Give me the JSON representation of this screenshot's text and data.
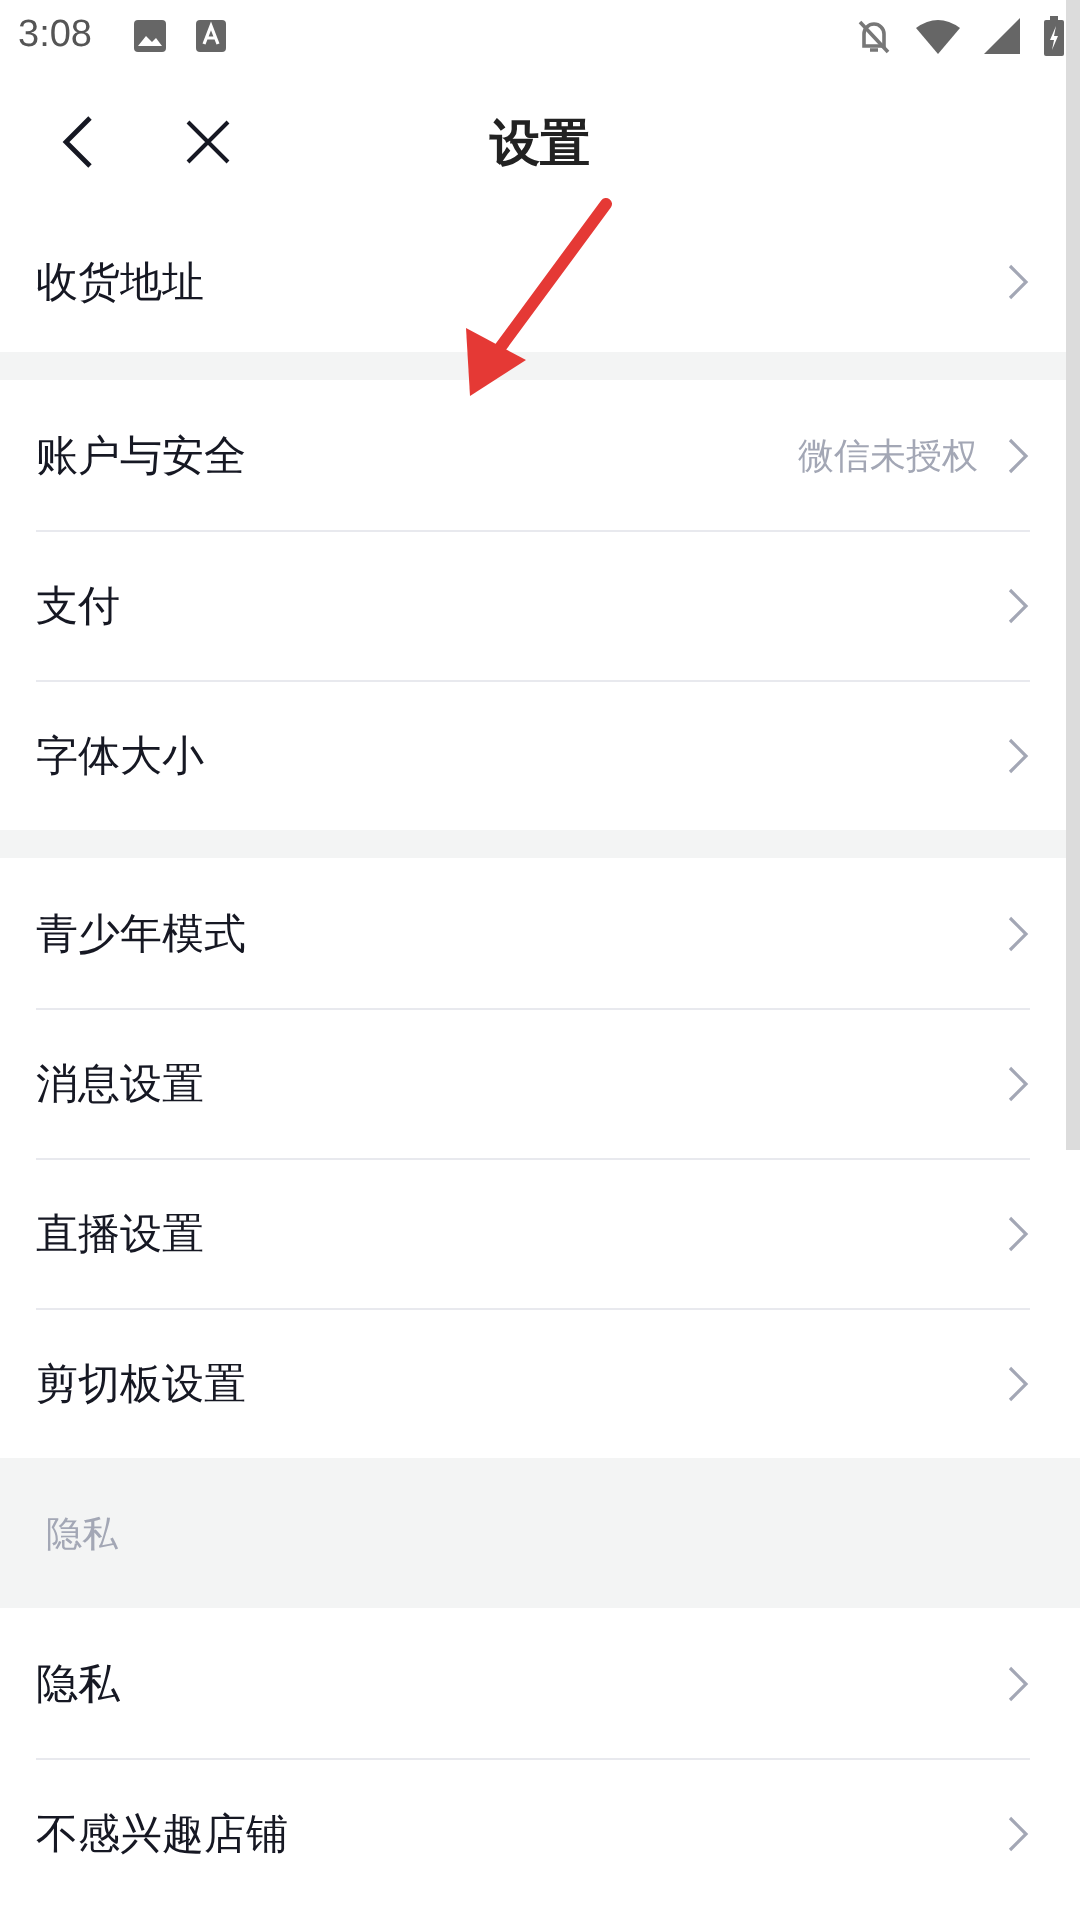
{
  "status_bar": {
    "time": "3:08"
  },
  "header": {
    "title": "设置"
  },
  "groups": [
    {
      "items": [
        {
          "label": "收货地址"
        }
      ]
    },
    {
      "items": [
        {
          "label": "账户与安全",
          "value": "微信未授权"
        },
        {
          "label": "支付"
        },
        {
          "label": "字体大小"
        }
      ]
    },
    {
      "items": [
        {
          "label": "青少年模式"
        },
        {
          "label": "消息设置"
        },
        {
          "label": "直播设置"
        },
        {
          "label": "剪切板设置"
        }
      ]
    },
    {
      "title": "隐私",
      "items": [
        {
          "label": "隐私"
        },
        {
          "label": "不感兴趣店铺"
        }
      ]
    }
  ]
}
